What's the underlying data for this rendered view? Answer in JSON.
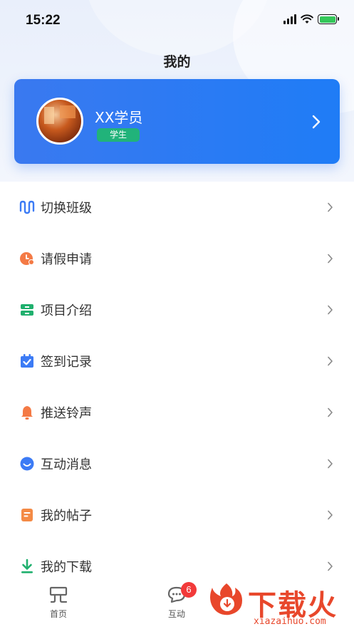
{
  "status_bar": {
    "time": "15:22"
  },
  "page_title": "我的",
  "profile": {
    "name": "XX学员",
    "role": "学生"
  },
  "menu": [
    {
      "label": "切换班级",
      "icon": "switch-class-icon",
      "color": "#3c7bf5"
    },
    {
      "label": "请假申请",
      "icon": "clock-icon",
      "color": "#f47a45"
    },
    {
      "label": "项目介绍",
      "icon": "cabinet-icon",
      "color": "#20b06e"
    },
    {
      "label": "签到记录",
      "icon": "calendar-check-icon",
      "color": "#3c7bf5"
    },
    {
      "label": "推送铃声",
      "icon": "bell-icon",
      "color": "#f47a45"
    },
    {
      "label": "互动消息",
      "icon": "smile-icon",
      "color": "#3c7bf5"
    },
    {
      "label": "我的帖子",
      "icon": "document-icon",
      "color": "#f48a45"
    },
    {
      "label": "我的下载",
      "icon": "download-icon",
      "color": "#20b06e"
    }
  ],
  "tabbar": {
    "home_label": "首页",
    "interact_label": "互动",
    "interact_badge": "6"
  },
  "watermark": {
    "text": "下载火",
    "domain": "xiazaihuo.com"
  },
  "colors": {
    "card_start": "#3a79f0",
    "card_end": "#1f7cf6",
    "role_badge": "#21b37a",
    "badge_red": "#f23a3a"
  }
}
